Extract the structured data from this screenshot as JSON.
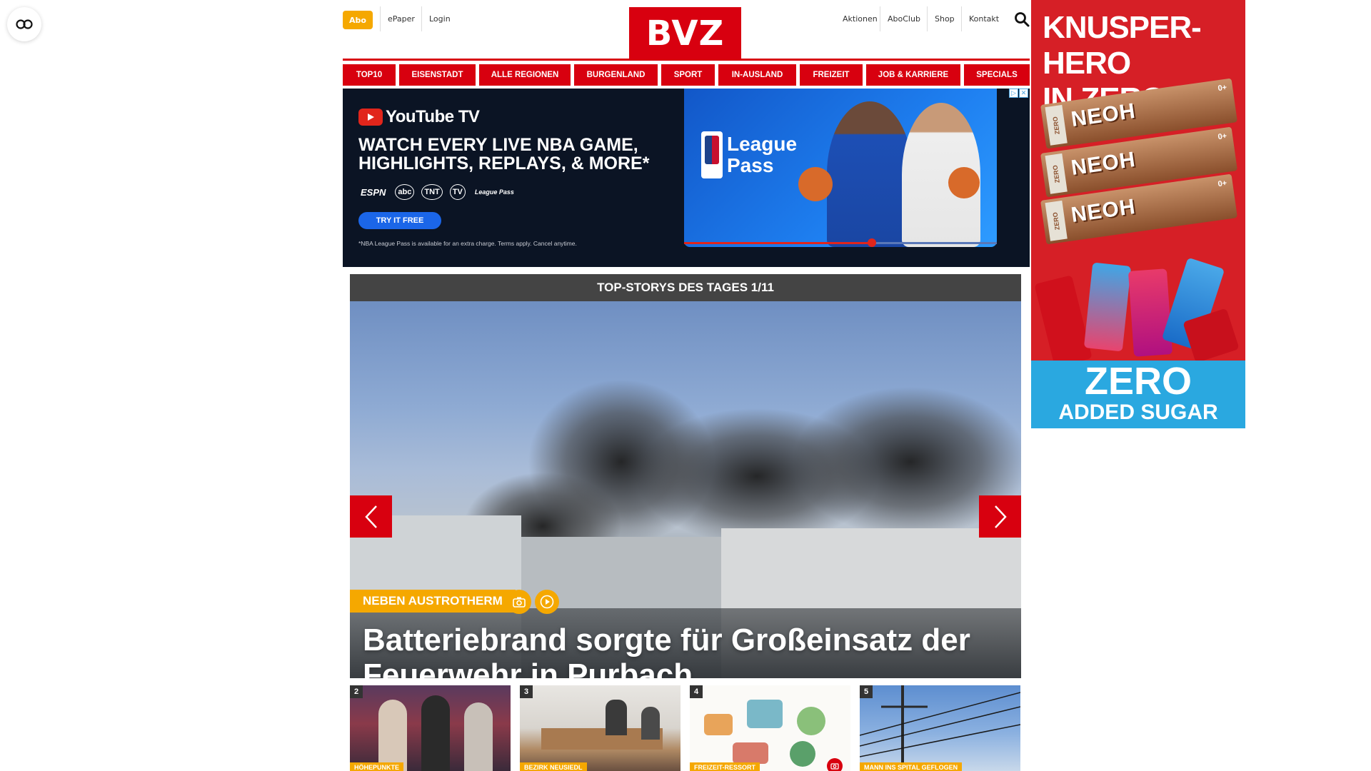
{
  "header": {
    "abo_label": "Abo",
    "left_links": [
      "ePaper",
      "Login"
    ],
    "logo_text": "BVZ",
    "right_links": [
      "Aktionen",
      "AboClub",
      "Shop",
      "Kontakt"
    ]
  },
  "nav": {
    "items": [
      "TOP10",
      "EISENSTADT",
      "ALLE REGIONEN",
      "BURGENLAND",
      "SPORT",
      "IN-AUSLAND",
      "FREIZEIT",
      "JOB & KARRIERE",
      "SPECIALS"
    ]
  },
  "banner_ad": {
    "brand": "YouTube TV",
    "headline_line1": "WATCH EVERY LIVE NBA GAME,",
    "headline_line2": "HIGHLIGHTS, REPLAYS, & MORE*",
    "partners": [
      "ESPN",
      "abc",
      "TNT",
      "TV",
      "League Pass"
    ],
    "cta_label": "TRY IT FREE",
    "fine_print": "*NBA League Pass is available for an extra charge. Terms apply. Cancel anytime.",
    "product_line1": "League",
    "product_line2": "Pass",
    "progress": 0.6
  },
  "sky_ad": {
    "headline_line1": "KNUSPER-HERO",
    "headline_line2": "IN ZERO!",
    "bar_label": "NEOH",
    "bar_side": "ZERO",
    "bar_badge": "0+",
    "footer_big": "ZERO",
    "footer_small": "ADDED SUGAR"
  },
  "top_stories": {
    "header": "TOP-STORYS DES TAGES 1/11",
    "tag": "NEBEN AUSTROTHERM",
    "headline_line1": "Batteriebrand sorgte für Großeinsatz der",
    "headline_line2": "Feuerwehr in Purbach"
  },
  "thumbs": [
    {
      "number": "2",
      "category": "HÖHEPUNKTE"
    },
    {
      "number": "3",
      "category": "BEZIRK NEUSIEDL"
    },
    {
      "number": "4",
      "category": "FREIZEIT-RESSORT"
    },
    {
      "number": "5",
      "category": "MANN INS SPITAL GEFLOGEN"
    }
  ],
  "colors": {
    "brand_red": "#d8000f",
    "accent_yellow": "#f5a800"
  }
}
